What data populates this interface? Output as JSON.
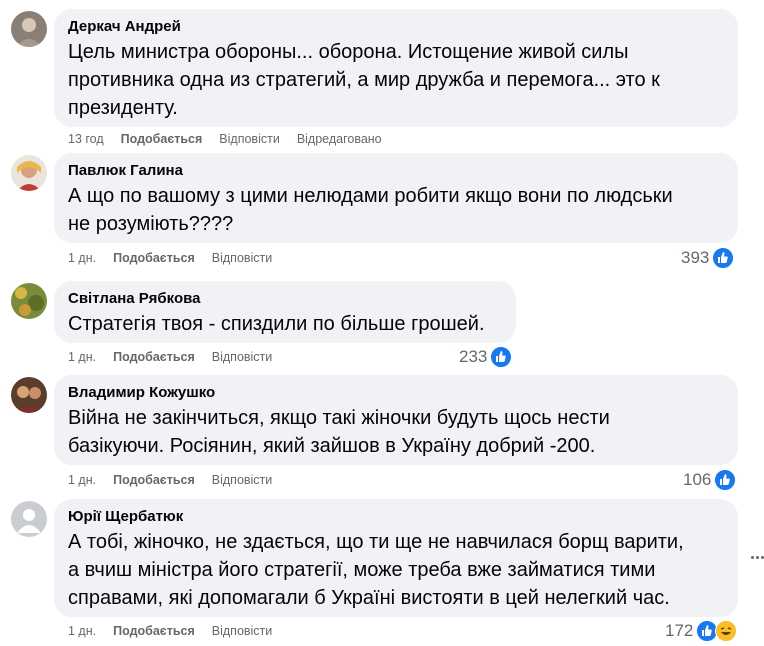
{
  "comments": [
    {
      "author": "Деркач Андрей",
      "text_lines": [
        "Цель министра обороны... оборона. Истощение живой силы",
        "противника одна из стратегий, а мир дружба и перемога... это к",
        "президенту."
      ],
      "time": "13 год",
      "like_label": "Подобається",
      "reply_label": "Відповісти",
      "edited_label": "Відредаговано",
      "reaction_count": ""
    },
    {
      "author": "Павлюк Галина",
      "text_lines": [
        "А що по вашому з цими нелюдами робити якщо вони по людськи",
        "не розуміють????"
      ],
      "time": "1 дн.",
      "like_label": "Подобається",
      "reply_label": "Відповісти",
      "reaction_count": "393"
    },
    {
      "author": "Світлана Рябкова",
      "text_lines": [
        "Стратегія твоя - спиздили по більше грошей."
      ],
      "time": "1 дн.",
      "like_label": "Подобається",
      "reply_label": "Відповісти",
      "reaction_count": "233"
    },
    {
      "author": "Владимир Кожушко",
      "text_lines": [
        "Війна не закінчиться, якщо такі жіночки будуть щось нести",
        "базікуючи. Росіянин, який зайшов в Україну добрий -200."
      ],
      "time": "1 дн.",
      "like_label": "Подобається",
      "reply_label": "Відповісти",
      "reaction_count": "106"
    },
    {
      "author": "Юрії Щербатюк",
      "text_lines": [
        "А тобі, жіночко, не здається, що ти ще не навчилася борщ варити,",
        "а вчиш міністра його стратегії, може треба вже займатися тими",
        "справами, які допомагали б Україні вистояти в цей нелегкий час."
      ],
      "time": "1 дн.",
      "like_label": "Подобається",
      "reply_label": "Відповісти",
      "reaction_count": "172"
    }
  ],
  "icons": {
    "like": "like-icon",
    "haha": "haha-icon",
    "more": "more-options-icon"
  },
  "colors": {
    "bubble": "#f0f2f5",
    "meta_text": "#65676b",
    "like_blue": "#1877f2",
    "haha_yellow": "#fbbd22"
  }
}
